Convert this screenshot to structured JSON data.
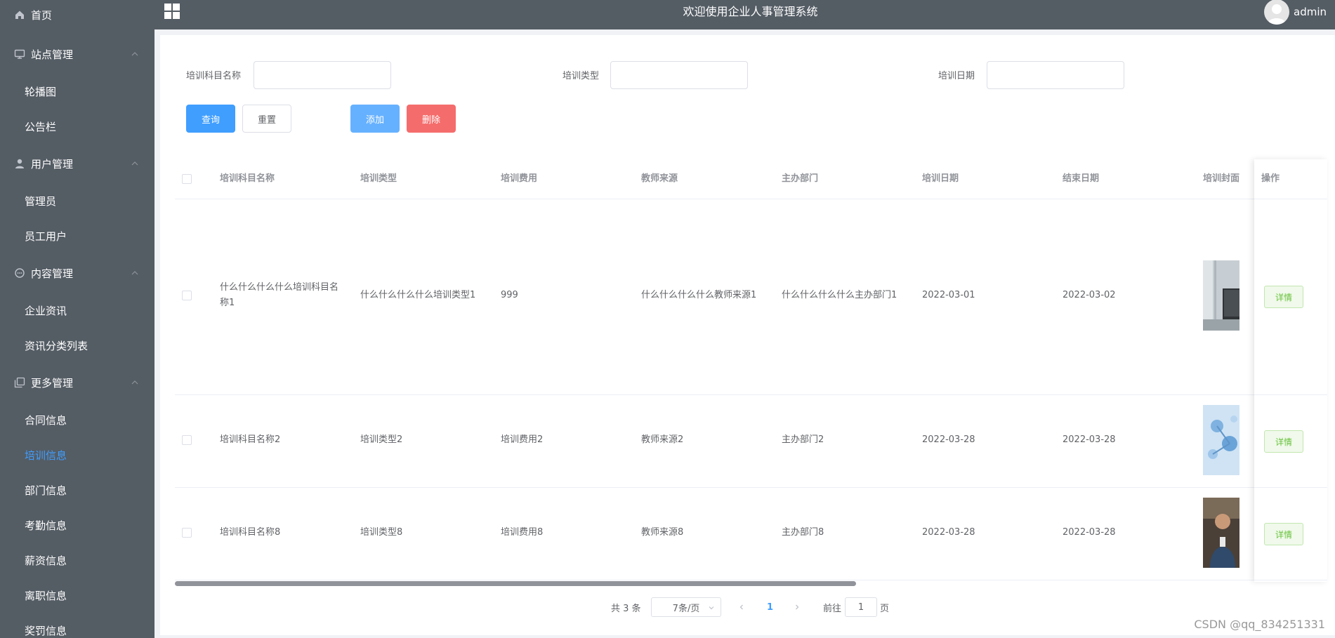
{
  "header": {
    "title": "欢迎使用企业人事管理系统",
    "user": "admin"
  },
  "sidebar": {
    "items": [
      {
        "label": "首页",
        "icon": "home-icon",
        "level": "top"
      },
      {
        "label": "站点管理",
        "icon": "monitor-icon",
        "level": "top",
        "expanded": true
      },
      {
        "label": "轮播图",
        "level": "sub"
      },
      {
        "label": "公告栏",
        "level": "sub"
      },
      {
        "label": "用户管理",
        "icon": "user-icon",
        "level": "top",
        "expanded": true
      },
      {
        "label": "管理员",
        "level": "sub"
      },
      {
        "label": "员工用户",
        "level": "sub"
      },
      {
        "label": "内容管理",
        "icon": "chat-icon",
        "level": "top",
        "expanded": true
      },
      {
        "label": "企业资讯",
        "level": "sub"
      },
      {
        "label": "资讯分类列表",
        "level": "sub"
      },
      {
        "label": "更多管理",
        "icon": "copy-icon",
        "level": "top",
        "expanded": true
      },
      {
        "label": "合同信息",
        "level": "sub"
      },
      {
        "label": "培训信息",
        "level": "sub",
        "active": true
      },
      {
        "label": "部门信息",
        "level": "sub"
      },
      {
        "label": "考勤信息",
        "level": "sub"
      },
      {
        "label": "薪资信息",
        "level": "sub"
      },
      {
        "label": "离职信息",
        "level": "sub"
      },
      {
        "label": "奖罚信息",
        "level": "sub"
      }
    ]
  },
  "search": {
    "fields": [
      {
        "label": "培训科目名称",
        "value": ""
      },
      {
        "label": "培训类型",
        "value": ""
      },
      {
        "label": "培训日期",
        "value": ""
      }
    ],
    "buttons": {
      "query": "查询",
      "reset": "重置",
      "add": "添加",
      "delete": "删除"
    }
  },
  "table": {
    "columns": [
      "培训科目名称",
      "培训类型",
      "培训费用",
      "教师来源",
      "主办部门",
      "培训日期",
      "结束日期",
      "培训封面",
      "操作"
    ],
    "rows": [
      {
        "name": "什么什么什么什么培训科目名称1",
        "type": "什么什么什么什么培训类型1",
        "fee": "999",
        "teacher": "什么什么什么什么教师来源1",
        "dept": "什么什么什么什么主办部门1",
        "start": "2022-03-01",
        "end": "2022-03-02",
        "action": "详情"
      },
      {
        "name": "培训科目名称2",
        "type": "培训类型2",
        "fee": "培训费用2",
        "teacher": "教师来源2",
        "dept": "主办部门2",
        "start": "2022-03-28",
        "end": "2022-03-28",
        "action": "详情"
      },
      {
        "name": "培训科目名称8",
        "type": "培训类型8",
        "fee": "培训费用8",
        "teacher": "教师来源8",
        "dept": "主办部门8",
        "start": "2022-03-28",
        "end": "2022-03-28",
        "action": "详情"
      }
    ]
  },
  "pagination": {
    "total": "共 3 条",
    "page_size": "7条/页",
    "current_page": "1",
    "goto_prefix": "前往",
    "goto_value": "1",
    "goto_suffix": "页"
  },
  "watermark": "CSDN @qq_834251331"
}
